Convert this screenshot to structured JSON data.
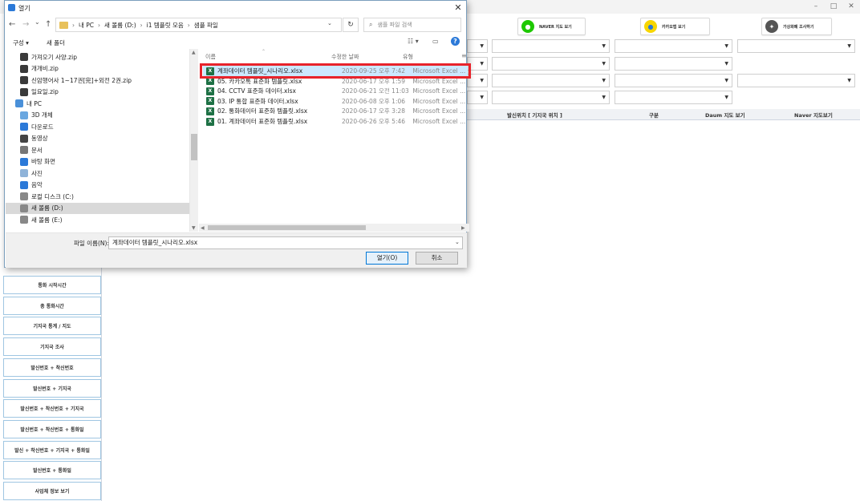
{
  "app": {
    "top_buttons": [
      {
        "label": "NAVER 지도 보기",
        "icon": "naver-map-icon",
        "color": "#1ec800"
      },
      {
        "label": "카카오맵 보기",
        "icon": "kakao-map-icon",
        "color": "#f7d600"
      },
      {
        "label": "가상화폐 조사하기",
        "icon": "crypto-icon",
        "color": "#555555"
      }
    ],
    "table_headers": [
      "발신위치 [ 기지국 위치 ]",
      "구분",
      "Daum 지도 보기",
      "Naver 지도보기"
    ],
    "sidebar_buttons": [
      "통화 시작시간",
      "총 통화시간",
      "기지국 통계 / 지도",
      "기지국 조사",
      "발신번호 + 착신번호",
      "발신번호 + 기지국",
      "발신번호 + 착신번호 + 기지국",
      "발신번호 + 착신번호 + 통화일",
      "발신 + 착신번호 + 기지국 + 통화일",
      "발신번호 + 통화일",
      "사업체 정보 보기"
    ],
    "window_controls": [
      "–",
      "□",
      "✕"
    ]
  },
  "dialog": {
    "title": "열기",
    "nav_back": "←",
    "nav_forward": "→",
    "nav_history": "⌄",
    "nav_up": "↑",
    "address": {
      "separator": "›",
      "segments": [
        "내 PC",
        "새 볼륨 (D:)",
        "i1 템플릿 모음",
        "샘플 파일"
      ]
    },
    "search_placeholder": "샘플 파일 검색",
    "toolbar": {
      "organize": "구성 ▾",
      "new_folder": "새 폴더"
    },
    "nav_items": [
      {
        "label": "가져오기 사양.zip",
        "icon": "zip-icon"
      },
      {
        "label": "개개비.zip",
        "icon": "zip-icon"
      },
      {
        "label": "신암행어사 1~17권[完]+외전 2권.zip",
        "icon": "zip-icon"
      },
      {
        "label": "일요일.zip",
        "icon": "zip-icon"
      },
      {
        "label": "내 PC",
        "icon": "pc-icon"
      },
      {
        "label": "3D 개체",
        "icon": "3d-objects-icon"
      },
      {
        "label": "다운로드",
        "icon": "download-icon"
      },
      {
        "label": "동영상",
        "icon": "video-icon"
      },
      {
        "label": "문서",
        "icon": "document-icon"
      },
      {
        "label": "바탕 화면",
        "icon": "desktop-icon"
      },
      {
        "label": "사진",
        "icon": "pictures-icon"
      },
      {
        "label": "음악",
        "icon": "music-icon"
      },
      {
        "label": "로컬 디스크 (C:)",
        "icon": "drive-icon"
      },
      {
        "label": "새 볼륨 (D:)",
        "icon": "drive-icon",
        "selected": true
      },
      {
        "label": "새 볼륨 (E:)",
        "icon": "drive-icon"
      }
    ],
    "columns": {
      "name": "이름",
      "date": "수정한 날짜",
      "type": "유형"
    },
    "files": [
      {
        "name": "계좌데이터 템플릿_시나리오.xlsx",
        "date": "2020-09-25 오후 7:42",
        "type": "Microsoft Excel ...",
        "highlighted": true
      },
      {
        "name": "05. 카카오톡 표준화 템플릿.xlsx",
        "date": "2020-06-17 오후 1:59",
        "type": "Microsoft Excel ..."
      },
      {
        "name": "04. CCTV 표준화 데이터.xlsx",
        "date": "2020-06-21 오전 11:03",
        "type": "Microsoft Excel ..."
      },
      {
        "name": "03. IP 통합 표준화 데이터.xlsx",
        "date": "2020-06-08 오후 1:06",
        "type": "Microsoft Excel ..."
      },
      {
        "name": "02. 통화데이터 표준화 템플릿.xlsx",
        "date": "2020-06-17 오후 3:28",
        "type": "Microsoft Excel ..."
      },
      {
        "name": "01. 계좌데이터 표준화 템플릿.xlsx",
        "date": "2020-06-26 오후 5:46",
        "type": "Microsoft Excel ..."
      }
    ],
    "filename_label": "파일 이름(N):",
    "filename_value": "계좌데이터 템플릿_시나리오.xlsx",
    "open_button": "열기(O)",
    "cancel_button": "취소"
  }
}
